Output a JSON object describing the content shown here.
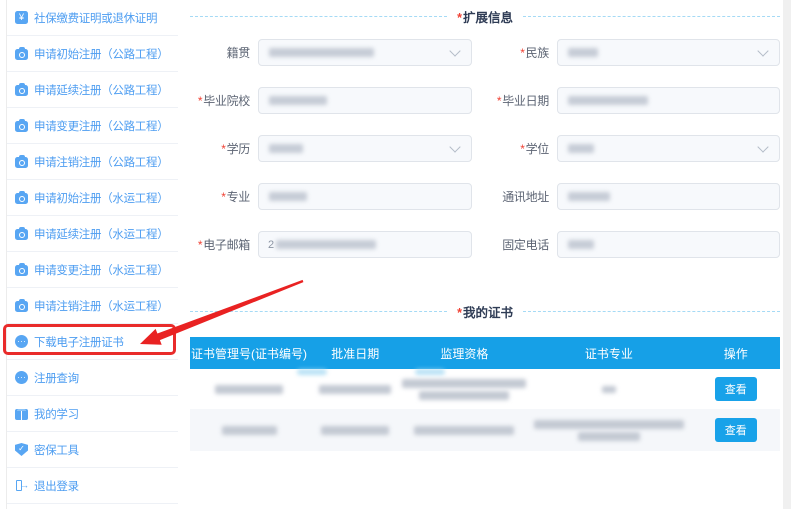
{
  "colors": {
    "sidebar_link_blue": "#4d9df1",
    "icon_blue": "#58a6f3",
    "table_header_blue": "#16a0e7",
    "button_blue": "#18a2e9",
    "highlight_red": "#e92b2b",
    "required_red": "#f04134",
    "section_title_navy": "#2f3c55",
    "dashed_line_blue": "#a5daf5"
  },
  "sidebar": {
    "items": [
      {
        "name": "sidebar-item-social-insurance-proof",
        "label": "社保缴费证明或退休证明",
        "icon": "yen-badge-icon",
        "highlighted": false
      },
      {
        "name": "sidebar-item-initial-registration-highway",
        "label": "申请初始注册（公路工程）",
        "icon": "briefcase-icon",
        "highlighted": false
      },
      {
        "name": "sidebar-item-renewal-registration-highway",
        "label": "申请延续注册（公路工程）",
        "icon": "briefcase-icon",
        "highlighted": false
      },
      {
        "name": "sidebar-item-change-registration-highway",
        "label": "申请变更注册（公路工程）",
        "icon": "briefcase-icon",
        "highlighted": false
      },
      {
        "name": "sidebar-item-cancel-registration-highway",
        "label": "申请注销注册（公路工程）",
        "icon": "briefcase-icon",
        "highlighted": false
      },
      {
        "name": "sidebar-item-initial-registration-waterway",
        "label": "申请初始注册（水运工程）",
        "icon": "briefcase-icon",
        "highlighted": false
      },
      {
        "name": "sidebar-item-renewal-registration-waterway",
        "label": "申请延续注册（水运工程）",
        "icon": "briefcase-icon",
        "highlighted": false
      },
      {
        "name": "sidebar-item-change-registration-waterway",
        "label": "申请变更注册（水运工程）",
        "icon": "briefcase-icon",
        "highlighted": false
      },
      {
        "name": "sidebar-item-cancel-registration-waterway",
        "label": "申请注销注册（水运工程）",
        "icon": "briefcase-icon",
        "highlighted": false
      },
      {
        "name": "sidebar-item-download-e-certificate",
        "label": "下载电子注册证书",
        "icon": "ellipsis-circle-icon",
        "highlighted": true
      },
      {
        "name": "sidebar-item-registration-query",
        "label": "注册查询",
        "icon": "ellipsis-circle-icon",
        "highlighted": false
      },
      {
        "name": "sidebar-item-my-learning",
        "label": "我的学习",
        "icon": "book-icon",
        "highlighted": false
      },
      {
        "name": "sidebar-item-security-tool",
        "label": "密保工具",
        "icon": "shield-check-icon",
        "highlighted": false
      },
      {
        "name": "sidebar-item-logout",
        "label": "退出登录",
        "icon": "logout-icon",
        "highlighted": false
      }
    ]
  },
  "form": {
    "section_title": "扩展信息",
    "required_mark": "*",
    "fields": [
      {
        "name": "native-place",
        "label": "籍贯",
        "required": false,
        "control": "select",
        "blur_w": 105,
        "value_visible": ""
      },
      {
        "name": "ethnicity",
        "label": "民族",
        "required": true,
        "control": "select",
        "blur_w": 30,
        "value_visible": ""
      },
      {
        "name": "graduate-school",
        "label": "毕业院校",
        "required": true,
        "control": "input",
        "blur_w": 58,
        "value_visible": ""
      },
      {
        "name": "graduation-date",
        "label": "毕业日期",
        "required": true,
        "control": "input",
        "blur_w": 80,
        "value_visible": ""
      },
      {
        "name": "education-level",
        "label": "学历",
        "required": true,
        "control": "select",
        "blur_w": 34,
        "value_visible": ""
      },
      {
        "name": "degree",
        "label": "学位",
        "required": true,
        "control": "select",
        "blur_w": 26,
        "value_visible": ""
      },
      {
        "name": "major",
        "label": "专业",
        "required": true,
        "control": "input",
        "blur_w": 38,
        "value_visible": ""
      },
      {
        "name": "mailing-address",
        "label": "通讯地址",
        "required": false,
        "control": "input",
        "blur_w": 42,
        "value_visible": ""
      },
      {
        "name": "email",
        "label": "电子邮箱",
        "required": true,
        "control": "input",
        "blur_w": 100,
        "value_visible": "2"
      },
      {
        "name": "landline-phone",
        "label": "固定电话",
        "required": false,
        "control": "input",
        "blur_w": 26,
        "value_visible": ""
      }
    ]
  },
  "certificates": {
    "section_title": "我的证书",
    "required_mark": "*",
    "columns": [
      "证书管理号(证书编号)",
      "批准日期",
      "监理资格",
      "证书专业",
      "操作"
    ],
    "action_label": "查看",
    "row_count": 2,
    "values_redacted": true
  },
  "annotation": {
    "type": "red-arrow",
    "points_to": "下载电子注册证书"
  }
}
